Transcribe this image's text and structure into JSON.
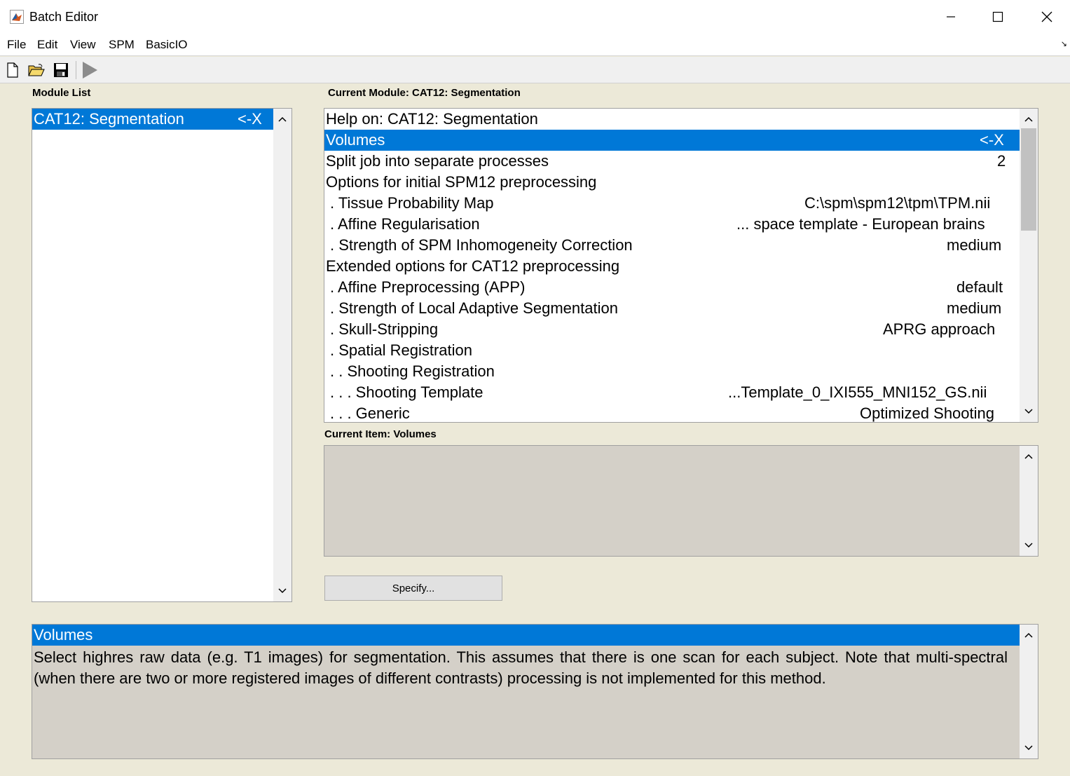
{
  "window": {
    "title": "Batch Editor"
  },
  "menu": [
    "File",
    "Edit",
    "View",
    "SPM",
    "BasicIO"
  ],
  "toolbar": {
    "icons": [
      "new-file-icon",
      "open-folder-icon",
      "save-icon",
      "run-icon"
    ]
  },
  "module_list": {
    "label": "Module List",
    "items": [
      {
        "name": "CAT12: Segmentation",
        "value": "<-X",
        "selected": true
      }
    ]
  },
  "current_module": {
    "label": "Current Module: CAT12: Segmentation",
    "items": [
      {
        "name": "Help on: CAT12: Segmentation",
        "value": ""
      },
      {
        "name": "Volumes",
        "value": "<-X",
        "selected": true
      },
      {
        "name": "Split job into separate processes",
        "value": "2"
      },
      {
        "name": "Options for initial SPM12 preprocessing",
        "value": ""
      },
      {
        "name": ". Tissue Probability Map",
        "value": "C:\\spm\\spm12\\tpm\\TPM.nii"
      },
      {
        "name": ". Affine Regularisation",
        "value": "... space template - European brains"
      },
      {
        "name": ". Strength of SPM Inhomogeneity Correction",
        "value": "medium"
      },
      {
        "name": "Extended options for CAT12 preprocessing",
        "value": ""
      },
      {
        "name": ". Affine Preprocessing (APP)",
        "value": "default"
      },
      {
        "name": ". Strength of Local Adaptive Segmentation",
        "value": "medium"
      },
      {
        "name": ". Skull-Stripping",
        "value": "APRG approach"
      },
      {
        "name": ". Spatial Registration",
        "value": ""
      },
      {
        "name": ". . Shooting Registration",
        "value": ""
      },
      {
        "name": ". . . Shooting Template",
        "value": "...Template_0_IXI555_MNI152_GS.nii"
      },
      {
        "name": ". . . Generic",
        "value": "Optimized Shooting"
      }
    ]
  },
  "current_item": {
    "label": "Current Item: Volumes"
  },
  "specify_button": "Specify...",
  "help_panel": {
    "title": "Volumes",
    "text": "Select highres raw data (e.g. T1 images) for segmentation. This assumes that there is one scan for each subject. Note that multi-spectral (when there are two or more registered images of different contrasts) processing is not implemented for this method."
  },
  "colors": {
    "selection": "#0078d7",
    "background": "#ece9d8",
    "panel_gray": "#d4d0c8"
  }
}
